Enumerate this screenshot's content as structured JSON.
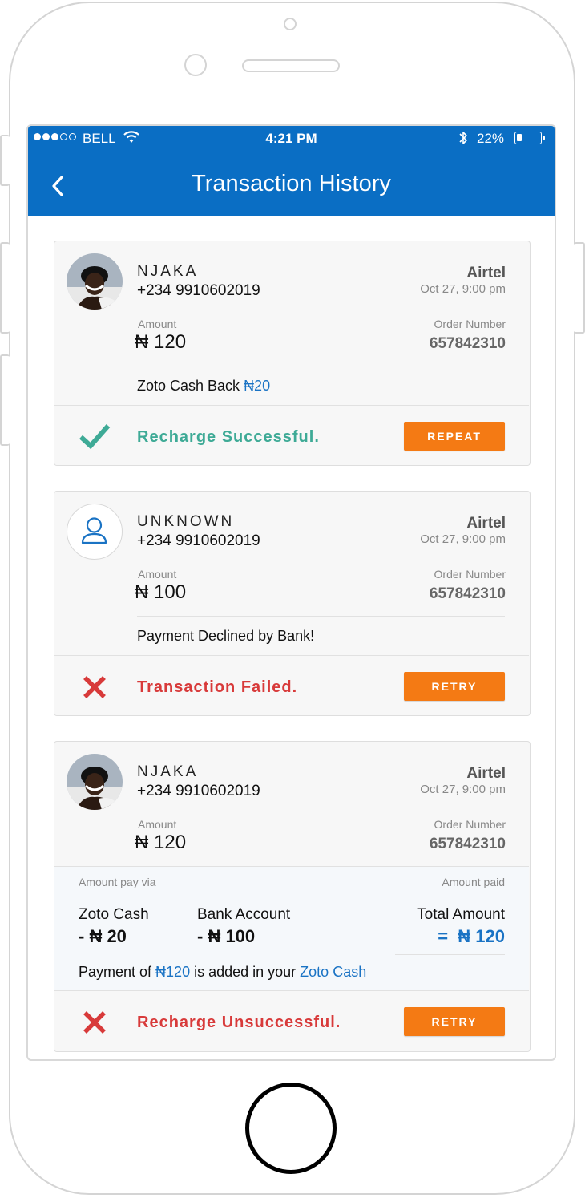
{
  "status_bar": {
    "carrier": "BELL",
    "time": "4:21 PM",
    "battery": "22%",
    "battery_level": 0.22,
    "icons": [
      "signal-dots-icon",
      "wifi-icon",
      "bluetooth-icon",
      "battery-icon"
    ]
  },
  "header": {
    "title": "Transaction History",
    "back_icon": "chevron-left-icon"
  },
  "colors": {
    "app_bar": "#0a6ec4",
    "accent_orange": "#f47a14",
    "success": "#3eaa96",
    "error": "#d83a3a",
    "link_blue": "#1a73c4"
  },
  "transactions": [
    {
      "name": "NJAKA",
      "phone": "+234 9910602019",
      "operator": "Airtel",
      "date": "Oct 27, 9:00 pm",
      "amount_label": "Amount",
      "amount": "₦ 120",
      "order_label": "Order Number",
      "order_number": "657842310",
      "note_prefix": "Zoto Cash Back ",
      "note_value": "₦20",
      "status": "Recharge Successful.",
      "status_icon": "check-icon",
      "action": "REPEAT"
    },
    {
      "name": "UNKNOWN",
      "phone": "+234 9910602019",
      "operator": "Airtel",
      "date": "Oct 27, 9:00 pm",
      "amount_label": "Amount",
      "amount": "₦ 100",
      "order_label": "Order Number",
      "order_number": "657842310",
      "note": "Payment Declined by Bank!",
      "status": "Transaction Failed.",
      "status_icon": "cross-icon",
      "action": "RETRY"
    },
    {
      "name": "NJAKA",
      "phone": "+234 9910602019",
      "operator": "Airtel",
      "date": "Oct 27, 9:00 pm",
      "amount_label": "Amount",
      "amount": "₦ 120",
      "order_label": "Order Number",
      "order_number": "657842310",
      "split": {
        "pay_via_label": "Amount pay via",
        "paid_label": "Amount paid",
        "zoto_name": "Zoto Cash",
        "zoto_value": "- ₦ 20",
        "bank_name": "Bank Account",
        "bank_value": "- ₦ 100",
        "total_name": "Total Amount",
        "total_value": "=  ₦ 120",
        "msg_prefix": "Payment of ",
        "msg_amount": "₦120",
        "msg_middle": " is added in your ",
        "msg_link": "Zoto Cash"
      },
      "status": "Recharge Unsuccessful.",
      "status_icon": "cross-icon",
      "action": "RETRY"
    }
  ]
}
